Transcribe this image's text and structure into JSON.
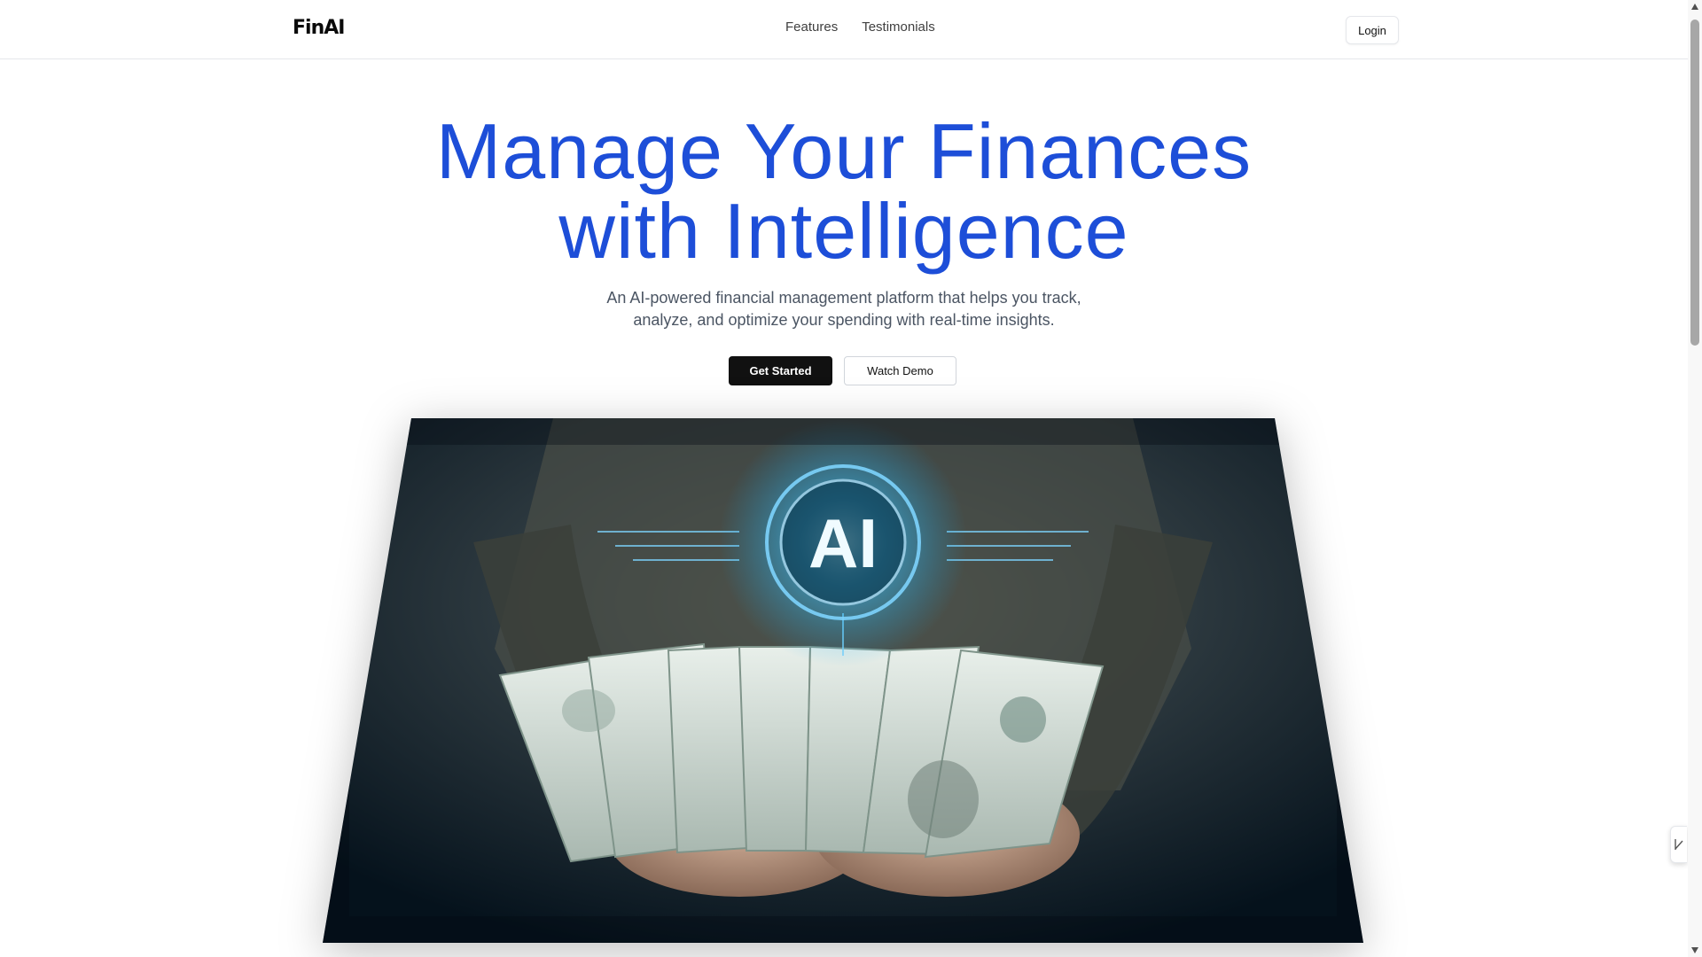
{
  "header": {
    "logo": "FinAI",
    "nav": [
      {
        "label": "Features"
      },
      {
        "label": "Testimonials"
      }
    ],
    "login_label": "Login"
  },
  "hero": {
    "title_line1": "Manage Your Finances",
    "title_line2": "with Intelligence",
    "subtitle_line1": "An AI-powered financial management platform that helps you track,",
    "subtitle_line2": "analyze, and optimize your spending with real-time insights.",
    "primary_cta": "Get Started",
    "secondary_cta": "Watch Demo",
    "image_badge": "AI"
  },
  "colors": {
    "accent": "#1d4ed8",
    "primary_button": "#111111",
    "glow": "#38bdf8"
  },
  "icons": {
    "side_widget": "trend-chart-icon"
  }
}
